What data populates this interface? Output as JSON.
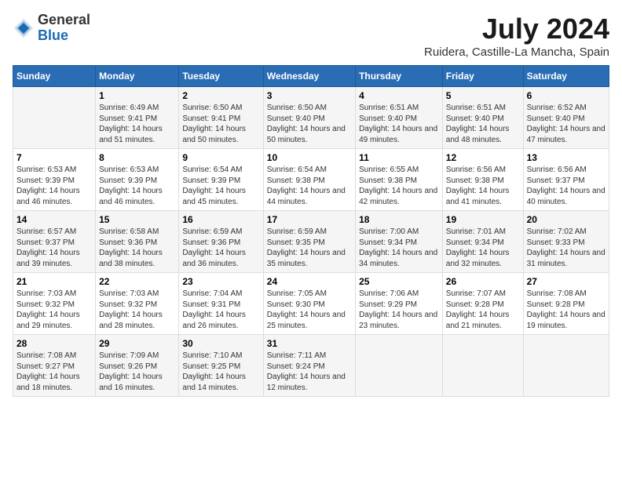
{
  "logo": {
    "general": "General",
    "blue": "Blue"
  },
  "title": "July 2024",
  "subtitle": "Ruidera, Castille-La Mancha, Spain",
  "days_of_week": [
    "Sunday",
    "Monday",
    "Tuesday",
    "Wednesday",
    "Thursday",
    "Friday",
    "Saturday"
  ],
  "weeks": [
    [
      {
        "day": "",
        "sunrise": "",
        "sunset": "",
        "daylight": ""
      },
      {
        "day": "1",
        "sunrise": "6:49 AM",
        "sunset": "9:41 PM",
        "daylight": "14 hours and 51 minutes."
      },
      {
        "day": "2",
        "sunrise": "6:50 AM",
        "sunset": "9:41 PM",
        "daylight": "14 hours and 50 minutes."
      },
      {
        "day": "3",
        "sunrise": "6:50 AM",
        "sunset": "9:40 PM",
        "daylight": "14 hours and 50 minutes."
      },
      {
        "day": "4",
        "sunrise": "6:51 AM",
        "sunset": "9:40 PM",
        "daylight": "14 hours and 49 minutes."
      },
      {
        "day": "5",
        "sunrise": "6:51 AM",
        "sunset": "9:40 PM",
        "daylight": "14 hours and 48 minutes."
      },
      {
        "day": "6",
        "sunrise": "6:52 AM",
        "sunset": "9:40 PM",
        "daylight": "14 hours and 47 minutes."
      }
    ],
    [
      {
        "day": "7",
        "sunrise": "6:53 AM",
        "sunset": "9:39 PM",
        "daylight": "14 hours and 46 minutes."
      },
      {
        "day": "8",
        "sunrise": "6:53 AM",
        "sunset": "9:39 PM",
        "daylight": "14 hours and 46 minutes."
      },
      {
        "day": "9",
        "sunrise": "6:54 AM",
        "sunset": "9:39 PM",
        "daylight": "14 hours and 45 minutes."
      },
      {
        "day": "10",
        "sunrise": "6:54 AM",
        "sunset": "9:38 PM",
        "daylight": "14 hours and 44 minutes."
      },
      {
        "day": "11",
        "sunrise": "6:55 AM",
        "sunset": "9:38 PM",
        "daylight": "14 hours and 42 minutes."
      },
      {
        "day": "12",
        "sunrise": "6:56 AM",
        "sunset": "9:38 PM",
        "daylight": "14 hours and 41 minutes."
      },
      {
        "day": "13",
        "sunrise": "6:56 AM",
        "sunset": "9:37 PM",
        "daylight": "14 hours and 40 minutes."
      }
    ],
    [
      {
        "day": "14",
        "sunrise": "6:57 AM",
        "sunset": "9:37 PM",
        "daylight": "14 hours and 39 minutes."
      },
      {
        "day": "15",
        "sunrise": "6:58 AM",
        "sunset": "9:36 PM",
        "daylight": "14 hours and 38 minutes."
      },
      {
        "day": "16",
        "sunrise": "6:59 AM",
        "sunset": "9:36 PM",
        "daylight": "14 hours and 36 minutes."
      },
      {
        "day": "17",
        "sunrise": "6:59 AM",
        "sunset": "9:35 PM",
        "daylight": "14 hours and 35 minutes."
      },
      {
        "day": "18",
        "sunrise": "7:00 AM",
        "sunset": "9:34 PM",
        "daylight": "14 hours and 34 minutes."
      },
      {
        "day": "19",
        "sunrise": "7:01 AM",
        "sunset": "9:34 PM",
        "daylight": "14 hours and 32 minutes."
      },
      {
        "day": "20",
        "sunrise": "7:02 AM",
        "sunset": "9:33 PM",
        "daylight": "14 hours and 31 minutes."
      }
    ],
    [
      {
        "day": "21",
        "sunrise": "7:03 AM",
        "sunset": "9:32 PM",
        "daylight": "14 hours and 29 minutes."
      },
      {
        "day": "22",
        "sunrise": "7:03 AM",
        "sunset": "9:32 PM",
        "daylight": "14 hours and 28 minutes."
      },
      {
        "day": "23",
        "sunrise": "7:04 AM",
        "sunset": "9:31 PM",
        "daylight": "14 hours and 26 minutes."
      },
      {
        "day": "24",
        "sunrise": "7:05 AM",
        "sunset": "9:30 PM",
        "daylight": "14 hours and 25 minutes."
      },
      {
        "day": "25",
        "sunrise": "7:06 AM",
        "sunset": "9:29 PM",
        "daylight": "14 hours and 23 minutes."
      },
      {
        "day": "26",
        "sunrise": "7:07 AM",
        "sunset": "9:28 PM",
        "daylight": "14 hours and 21 minutes."
      },
      {
        "day": "27",
        "sunrise": "7:08 AM",
        "sunset": "9:28 PM",
        "daylight": "14 hours and 19 minutes."
      }
    ],
    [
      {
        "day": "28",
        "sunrise": "7:08 AM",
        "sunset": "9:27 PM",
        "daylight": "14 hours and 18 minutes."
      },
      {
        "day": "29",
        "sunrise": "7:09 AM",
        "sunset": "9:26 PM",
        "daylight": "14 hours and 16 minutes."
      },
      {
        "day": "30",
        "sunrise": "7:10 AM",
        "sunset": "9:25 PM",
        "daylight": "14 hours and 14 minutes."
      },
      {
        "day": "31",
        "sunrise": "7:11 AM",
        "sunset": "9:24 PM",
        "daylight": "14 hours and 12 minutes."
      },
      {
        "day": "",
        "sunrise": "",
        "sunset": "",
        "daylight": ""
      },
      {
        "day": "",
        "sunrise": "",
        "sunset": "",
        "daylight": ""
      },
      {
        "day": "",
        "sunrise": "",
        "sunset": "",
        "daylight": ""
      }
    ]
  ]
}
